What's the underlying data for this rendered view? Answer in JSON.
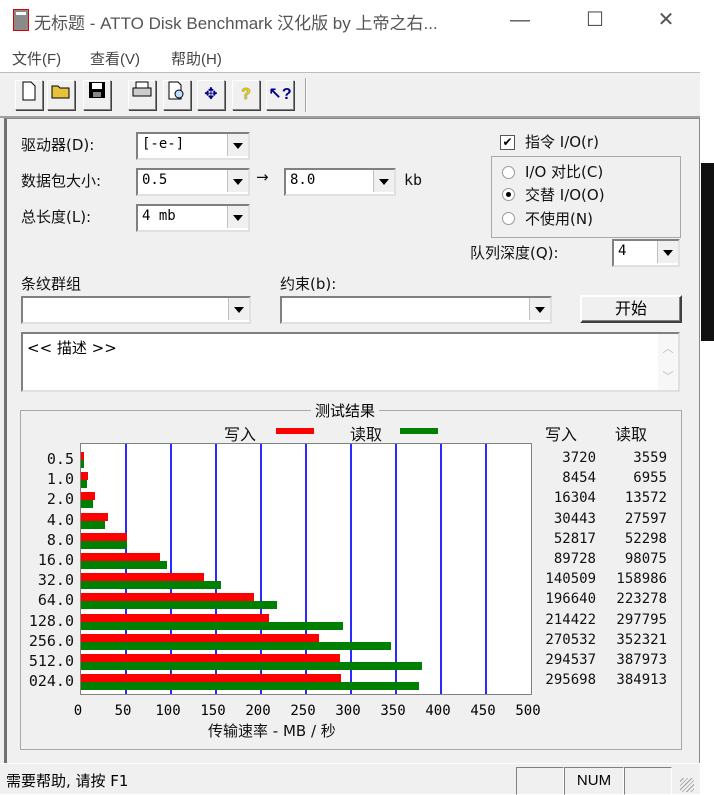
{
  "window": {
    "title": "无标题 - ATTO Disk Benchmark 汉化版 by 上帝之右...",
    "controls": {
      "minimize": "—",
      "maximize": "☐",
      "close": "✕"
    }
  },
  "menu": [
    "文件(F)",
    "查看(V)",
    "帮助(H)"
  ],
  "toolbar": [
    {
      "name": "new-document-icon",
      "glyph": "🗋"
    },
    {
      "name": "open-folder-icon",
      "glyph": "📂"
    },
    {
      "name": "save-icon",
      "glyph": "💾"
    },
    {
      "name": "print-icon",
      "glyph": "🖶"
    },
    {
      "name": "print-preview-icon",
      "glyph": "🔍"
    },
    {
      "name": "move-icon",
      "glyph": "✥"
    },
    {
      "name": "help-icon",
      "glyph": "?"
    },
    {
      "name": "context-help-icon",
      "glyph": "↖?"
    }
  ],
  "settings": {
    "drive_label": "驱动器(D):",
    "drive_value": "[-e-]",
    "transfer_label": "数据包大小:",
    "transfer_from": "0.5",
    "arrow": "→",
    "transfer_to": "8.0",
    "transfer_unit": "kb",
    "length_label": "总长度(L):",
    "length_value": "4 mb",
    "direct_io_label": "指令 I/O(r)",
    "direct_io_checked": true,
    "radio_io_compare": "I/O 对比(C)",
    "radio_overlapped": "交替 I/O(O)",
    "radio_neither": "不使用(N)",
    "radio_selected": "交替 I/O(O)",
    "queue_label": "队列深度(Q):",
    "queue_value": "4",
    "stripe_label": "条纹群组",
    "stripe_value": "",
    "constraint_label": "约束(b):",
    "constraint_value": "",
    "start_button": "开始",
    "description": "<< 描述 >>"
  },
  "results": {
    "title": "测试结果",
    "legend_write": "写入",
    "legend_read": "读取",
    "col_write": "写入",
    "col_read": "读取"
  },
  "chart_data": {
    "type": "bar",
    "orientation": "horizontal",
    "title": "测试结果",
    "xlabel": "传输速率 - MB / 秒",
    "ylabel": "",
    "xlim": [
      0,
      500
    ],
    "xticks": [
      "0",
      "50",
      "100",
      "150",
      "200",
      "250",
      "300",
      "350",
      "400",
      "450",
      "500"
    ],
    "grid": true,
    "legend": "top",
    "categories": [
      "0.5",
      "1.0",
      "2.0",
      "4.0",
      "8.0",
      "16.0",
      "32.0",
      "64.0",
      "128.0",
      "256.0",
      "512.0",
      "024.0"
    ],
    "series": [
      {
        "name": "写入",
        "color": "#ff0000",
        "values_kbps": [
          3720,
          8454,
          16304,
          30443,
          52817,
          89728,
          140509,
          196640,
          214422,
          270532,
          294537,
          295698
        ]
      },
      {
        "name": "读取",
        "color": "#008000",
        "values_kbps": [
          3559,
          6955,
          13572,
          27597,
          52298,
          98075,
          158986,
          223278,
          297795,
          352321,
          387973,
          384913
        ]
      }
    ]
  },
  "status": {
    "help_text": "需要帮助, 请按 F1",
    "num_indicator": "NUM"
  }
}
